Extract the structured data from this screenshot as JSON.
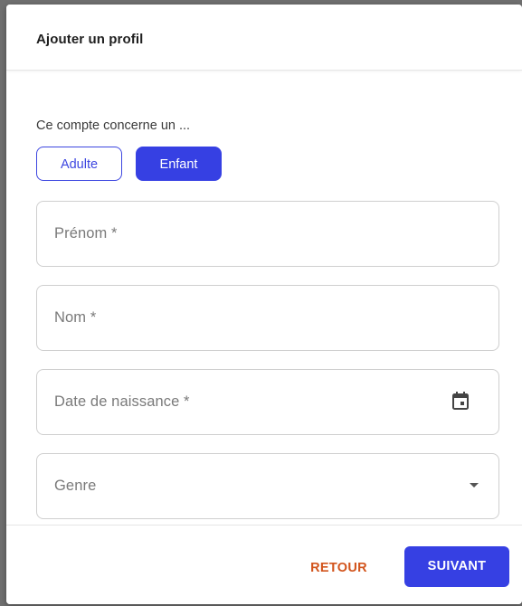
{
  "dialog": {
    "title": "Ajouter un profil"
  },
  "account_type": {
    "prompt": "Ce compte concerne un ...",
    "options": [
      {
        "label": "Adulte",
        "selected": false
      },
      {
        "label": "Enfant",
        "selected": true
      }
    ]
  },
  "fields": {
    "first_name": {
      "placeholder": "Prénom *",
      "value": ""
    },
    "last_name": {
      "placeholder": "Nom *",
      "value": ""
    },
    "birth_date": {
      "placeholder": "Date de naissance *",
      "value": "",
      "icon": "calendar-icon"
    },
    "gender": {
      "placeholder": "Genre",
      "value": "",
      "icon": "chevron-down-icon"
    }
  },
  "footer": {
    "back_label": "RETOUR",
    "next_label": "SUIVANT"
  },
  "colors": {
    "primary": "#3640e3",
    "secondary_text": "#d2541c",
    "border": "#cfcfcf"
  }
}
